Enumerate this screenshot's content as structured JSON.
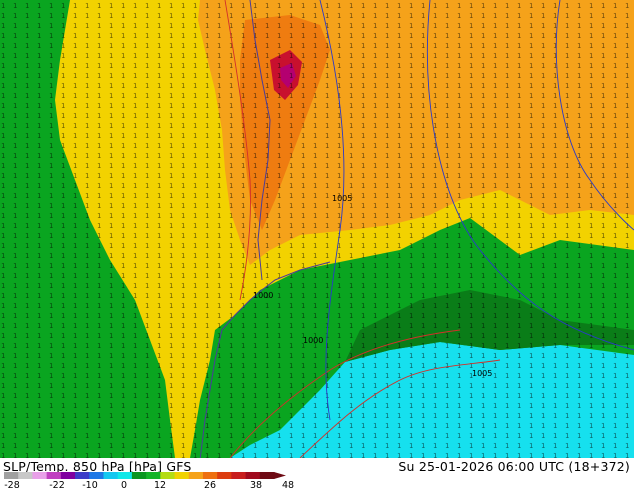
{
  "map": {
    "colors": {
      "sea_land_green": "#0c8c1e",
      "green_light": "#0aa520",
      "green_dark": "#0a7d18",
      "cyan_cold": "#16e0ee",
      "yellow_warm": "#f2d200",
      "orange_warm": "#f5a21a",
      "orange_hot": "#ef7c10",
      "red_core": "#c8102e",
      "magenta_core": "#b40070",
      "isobar_red": "#d2302a",
      "isobar_blue": "#2a3ac8",
      "coast": "#4a3c9a"
    },
    "pressure_labels": [
      "1000",
      "1005",
      "1005",
      "1000"
    ]
  },
  "footer": {
    "title_left": "SLP/Temp. 850 hPa [hPa] GFS",
    "title_right": "Su 25-01-2026 06:00 UTC (18+372)",
    "colorbar_ticks": [
      "-28",
      "-22",
      "-10",
      "0",
      "12",
      "26",
      "38",
      "48"
    ],
    "colorbar_colors": [
      "#a0a0a0",
      "#c8c8c8",
      "#e8a0e8",
      "#c040c0",
      "#8000a0",
      "#3c3cc8",
      "#1e78e6",
      "#14c8f0",
      "#10e8e8",
      "#0a9620",
      "#14b428",
      "#b4dc14",
      "#f0d200",
      "#f5a21a",
      "#ee7010",
      "#dc3c10",
      "#c81e1e",
      "#a00a1e",
      "#6e0a14"
    ]
  }
}
